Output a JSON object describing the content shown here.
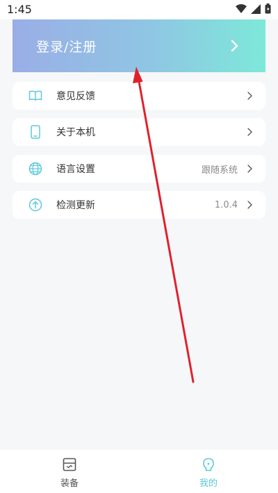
{
  "status_bar": {
    "time": "1:45",
    "icons": [
      "wifi-icon",
      "signal-icon",
      "battery-icon"
    ]
  },
  "login_banner": {
    "label": "登录/注册",
    "icon": "chevron-right-icon"
  },
  "menu": {
    "items": [
      {
        "label": "意见反馈",
        "value": "",
        "icon": "book-feedback-icon"
      },
      {
        "label": "关于本机",
        "value": "",
        "icon": "phone-icon"
      },
      {
        "label": "语言设置",
        "value": "跟随系统",
        "icon": "globe-icon"
      },
      {
        "label": "检测更新",
        "value": "1.0.4",
        "icon": "upload-circle-icon"
      }
    ]
  },
  "tab_bar": {
    "tabs": [
      {
        "label": "装备",
        "icon": "device-box-icon",
        "active": false
      },
      {
        "label": "我的",
        "icon": "profile-icon",
        "active": true
      }
    ]
  },
  "colors": {
    "accent": "#5ac8dc",
    "banner_gradient_start": "#9aaee6",
    "banner_gradient_end": "#7ee8d9",
    "annotation_arrow": "#e0202e"
  }
}
